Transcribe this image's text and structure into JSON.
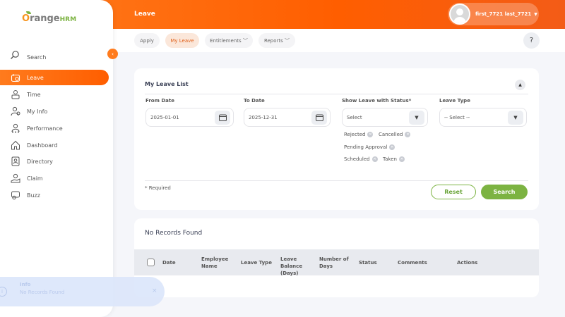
{
  "app": {
    "logo_text_orange": "O",
    "logo_text_main": "range",
    "logo_text_hrm": "HRM"
  },
  "header": {
    "title": "Leave",
    "user_name": "first_7721 last_7721",
    "caret": "▼"
  },
  "tabs": [
    {
      "label": "Apply",
      "active": false
    },
    {
      "label": "My Leave",
      "active": true
    },
    {
      "label": "Entitlements ﹀",
      "active": false
    },
    {
      "label": "Reports ﹀",
      "active": false
    }
  ],
  "help_label": "?",
  "sidebar": {
    "search_label": "Search",
    "collapse_glyph": "‹",
    "items": [
      {
        "label": "Leave",
        "icon": "leave-icon",
        "active": true
      },
      {
        "label": "Time",
        "icon": "time-icon"
      },
      {
        "label": "My Info",
        "icon": "my-info-icon"
      },
      {
        "label": "Performance",
        "icon": "performance-icon"
      },
      {
        "label": "Dashboard",
        "icon": "dashboard-icon"
      },
      {
        "label": "Directory",
        "icon": "directory-icon"
      },
      {
        "label": "Claim",
        "icon": "claim-icon"
      },
      {
        "label": "Buzz",
        "icon": "buzz-icon"
      }
    ]
  },
  "filter": {
    "title": "My Leave List",
    "from_label": "From Date",
    "from_value": "2025-01-01",
    "to_label": "To Date",
    "to_value": "2025-12-31",
    "status_label": "Show Leave with Status*",
    "status_value": "Select",
    "type_label": "Leave Type",
    "type_value": "-- Select --",
    "chips": [
      "Rejected",
      "Cancelled",
      "Pending Approval",
      "Scheduled",
      "Taken"
    ],
    "required_note": "* Required",
    "reset_label": "Reset",
    "search_label": "Search"
  },
  "results": {
    "title": "No Records Found",
    "columns": [
      "Date",
      "Employee Name",
      "Leave Type",
      "Leave Balance (Days)",
      "Number of Days",
      "Status",
      "Comments",
      "Actions"
    ]
  },
  "toast": {
    "title": "Info",
    "message": "No Records Found",
    "close": "×",
    "icon": "i"
  }
}
